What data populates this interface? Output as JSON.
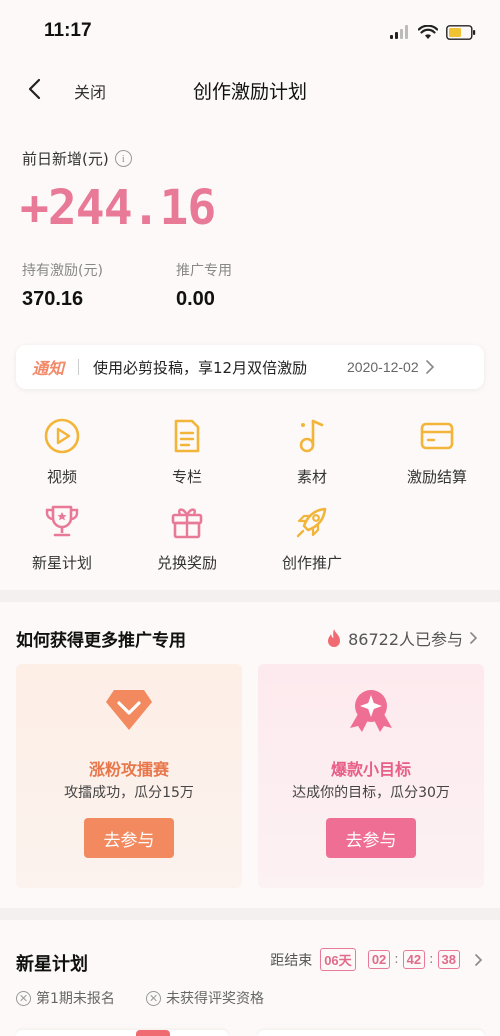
{
  "status_bar": {
    "time": "11:17"
  },
  "nav": {
    "close_label": "关闭",
    "title": "创作激励计划"
  },
  "earnings": {
    "yesterday_label": "前日新增(元)",
    "yesterday_value": "+244.16",
    "incentive_label": "持有激励(元)",
    "incentive_value": "370.16",
    "promo_label": "推广专用",
    "promo_value": "0.00"
  },
  "notice": {
    "tag": "通知",
    "text": "使用必剪投稿，享12月双倍激励",
    "date": "2020-12-02"
  },
  "grid": [
    {
      "label": "视频",
      "icon": "play-circle-icon"
    },
    {
      "label": "专栏",
      "icon": "document-icon"
    },
    {
      "label": "素材",
      "icon": "music-note-icon"
    },
    {
      "label": "激励结算",
      "icon": "card-icon"
    },
    {
      "label": "新星计划",
      "icon": "trophy-icon"
    },
    {
      "label": "兑换奖励",
      "icon": "gift-icon"
    },
    {
      "label": "创作推广",
      "icon": "rocket-icon"
    }
  ],
  "promo_section": {
    "title": "如何获得更多推广专用",
    "participants": "86722人已参与",
    "cards": [
      {
        "title": "涨粉攻擂赛",
        "subtitle": "攻擂成功，瓜分15万",
        "button": "去参与",
        "icon": "diamond-icon"
      },
      {
        "title": "爆款小目标",
        "subtitle": "达成你的目标，瓜分30万",
        "button": "去参与",
        "icon": "medal-icon"
      }
    ]
  },
  "newstar": {
    "title": "新星计划",
    "countdown_label": "距结束",
    "days": "06天",
    "hours": "02",
    "minutes": "42",
    "seconds": "38",
    "status_1": "第1期未报名",
    "status_2": "未获得评奖资格"
  },
  "colors": {
    "accent_pink": "#e87a98",
    "gold": "#f2b53a",
    "orange_button": "#f2895f",
    "pink_button": "#ef6e93"
  }
}
